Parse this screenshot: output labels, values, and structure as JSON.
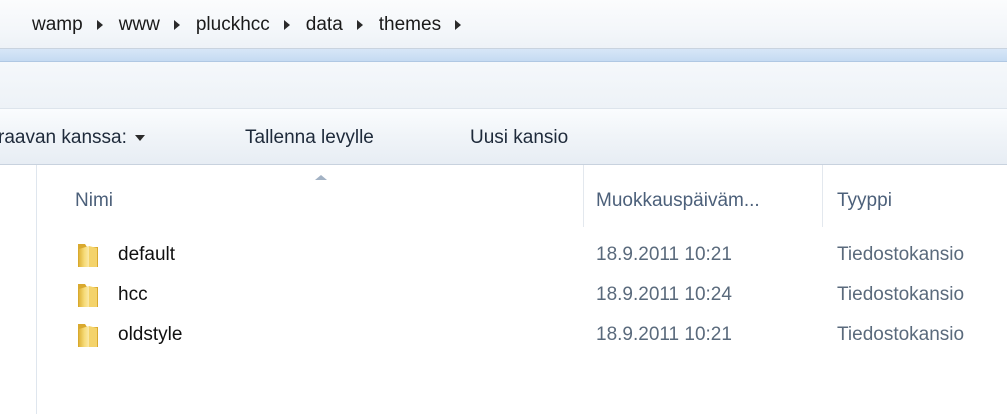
{
  "breadcrumb": {
    "items": [
      "wamp",
      "www",
      "pluckhcc",
      "data",
      "themes"
    ]
  },
  "commandbar": {
    "share_label": "raavan kanssa:",
    "burn_label": "Tallenna levylle",
    "new_folder_label": "Uusi kansio"
  },
  "columns": {
    "name": "Nimi",
    "date": "Muokkauspäiväm...",
    "type": "Tyyppi"
  },
  "files": [
    {
      "name": "default",
      "date": "18.9.2011 10:21",
      "type": "Tiedostokansio",
      "icon": "folder-icon"
    },
    {
      "name": "hcc",
      "date": "18.9.2011 10:24",
      "type": "Tiedostokansio",
      "icon": "folder-icon"
    },
    {
      "name": "oldstyle",
      "date": "18.9.2011 10:21",
      "type": "Tiedostokansio",
      "icon": "folder-icon"
    }
  ],
  "colors": {
    "header_text": "#4c607a",
    "meta_text": "#5a6a7c",
    "folder_yellow": "#f2c94c"
  }
}
